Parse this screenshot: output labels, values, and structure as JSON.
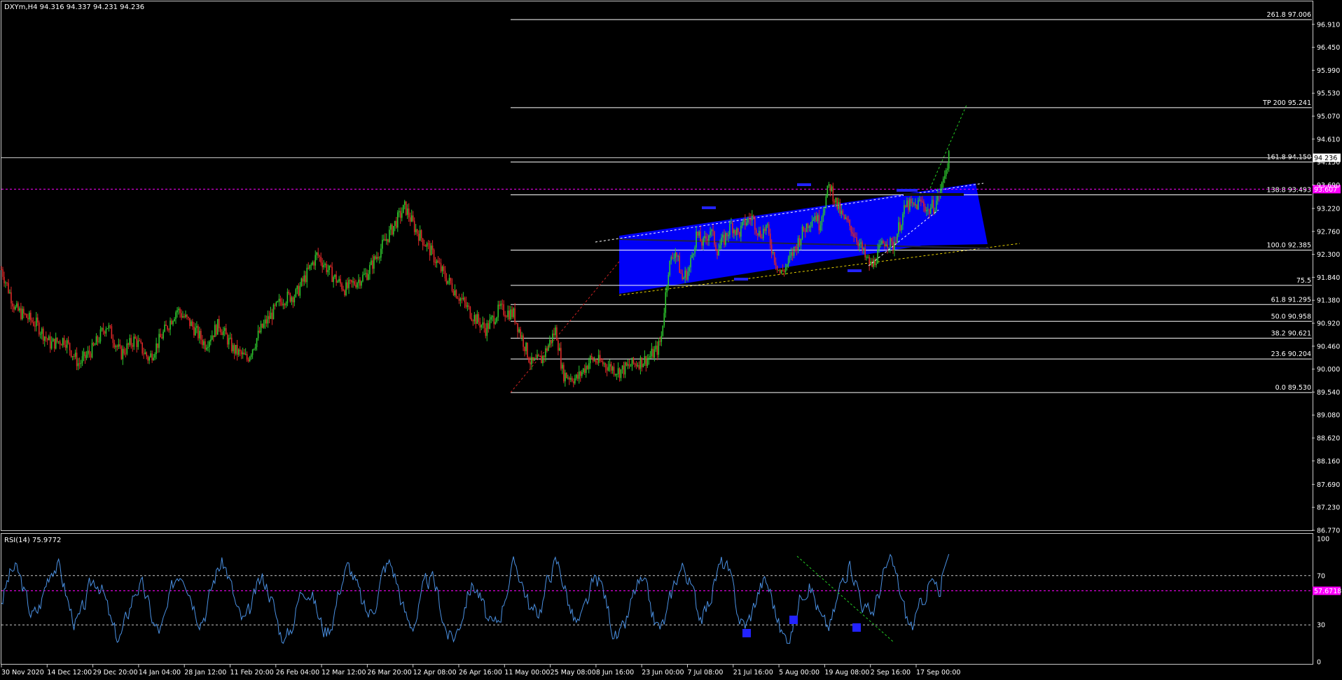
{
  "header": {
    "title": "DXYm,H4  94.316 94.337 94.231 94.236"
  },
  "rsi_panel": {
    "title": "RSI(14) 75.9772"
  },
  "colors": {
    "background": "#000000",
    "bull_candle": "#2ec82e",
    "bear_candle": "#dc2828",
    "channel_fill": "#0000ff",
    "fib_line": "#ffffff",
    "level_line": "#ff00ff",
    "rsi_line": "#4a90e2",
    "projection_line": "#22cc22"
  },
  "chart_data": [
    {
      "type": "candlestick",
      "symbol": "DXYm",
      "timeframe": "H4",
      "ohlc_last": {
        "open": 94.316,
        "high": 94.337,
        "low": 94.231,
        "close": 94.236
      },
      "current_price": "94.236",
      "ylim": [
        86.77,
        97.37
      ],
      "y_ticks": [
        "96.910",
        "96.450",
        "95.990",
        "95.530",
        "95.070",
        "94.610",
        "94.150",
        "93.690",
        "93.220",
        "92.760",
        "92.300",
        "91.840",
        "91.380",
        "90.920",
        "90.460",
        "90.000",
        "89.540",
        "89.080",
        "88.620",
        "88.160",
        "87.690",
        "87.230",
        "86.770"
      ],
      "x_ticks": [
        "30 Nov 2020",
        "14 Dec 12:00",
        "29 Dec 20:00",
        "14 Jan 04:00",
        "28 Jan 12:00",
        "11 Feb 20:00",
        "26 Feb 04:00",
        "12 Mar 12:00",
        "26 Mar 20:00",
        "12 Apr 08:00",
        "26 Apr 16:00",
        "11 May 00:00",
        "25 May 08:00",
        "8 Jun 16:00",
        "23 Jun 00:00",
        "7 Jul 08:00",
        "21 Jul 16:00",
        "5 Aug 00:00",
        "19 Aug 08:00",
        "2 Sep 16:00",
        "17 Sep 00:00"
      ],
      "price_path": [
        [
          0.0,
          92.0
        ],
        [
          0.02,
          91.2
        ],
        [
          0.05,
          90.9
        ],
        [
          0.07,
          90.5
        ],
        [
          0.09,
          90.6
        ],
        [
          0.11,
          90.1
        ],
        [
          0.13,
          90.4
        ],
        [
          0.15,
          90.9
        ],
        [
          0.17,
          90.3
        ],
        [
          0.19,
          90.6
        ],
        [
          0.21,
          90.2
        ],
        [
          0.23,
          90.7
        ],
        [
          0.25,
          91.2
        ],
        [
          0.27,
          90.9
        ],
        [
          0.29,
          90.5
        ],
        [
          0.31,
          90.9
        ],
        [
          0.33,
          90.4
        ],
        [
          0.35,
          90.2
        ],
        [
          0.37,
          90.8
        ],
        [
          0.4,
          91.4
        ],
        [
          0.42,
          91.5
        ],
        [
          0.45,
          92.3
        ],
        [
          0.47,
          91.9
        ],
        [
          0.49,
          91.6
        ],
        [
          0.52,
          91.9
        ],
        [
          0.54,
          92.4
        ],
        [
          0.56,
          92.9
        ],
        [
          0.575,
          93.25
        ],
        [
          0.59,
          92.8
        ],
        [
          0.61,
          92.4
        ],
        [
          0.63,
          91.9
        ],
        [
          0.65,
          91.5
        ],
        [
          0.67,
          91.1
        ],
        [
          0.69,
          90.8
        ],
        [
          0.71,
          91.2
        ],
        [
          0.73,
          91.1
        ],
        [
          0.745,
          90.5
        ],
        [
          0.755,
          90.1
        ],
        [
          0.77,
          90.2
        ],
        [
          0.79,
          90.8
        ],
        [
          0.8,
          89.9
        ],
        [
          0.82,
          89.8
        ],
        [
          0.84,
          90.2
        ],
        [
          0.86,
          90.1
        ],
        [
          0.88,
          89.95
        ],
        [
          0.9,
          90.1
        ],
        [
          0.92,
          90.2
        ],
        [
          0.935,
          90.4
        ],
        [
          0.94,
          90.6
        ],
        [
          0.95,
          92.0
        ],
        [
          0.96,
          92.4
        ],
        [
          0.97,
          91.8
        ],
        [
          0.98,
          92.0
        ],
        [
          0.99,
          92.7
        ],
        [
          1.0,
          92.5
        ],
        [
          1.01,
          92.8
        ],
        [
          1.02,
          92.4
        ],
        [
          1.03,
          92.6
        ],
        [
          1.04,
          92.9
        ],
        [
          1.05,
          92.7
        ],
        [
          1.06,
          92.95
        ],
        [
          1.07,
          93.05
        ],
        [
          1.08,
          92.7
        ],
        [
          1.09,
          92.85
        ],
        [
          1.1,
          92.3
        ],
        [
          1.11,
          91.9
        ],
        [
          1.12,
          92.1
        ],
        [
          1.13,
          92.4
        ],
        [
          1.14,
          92.7
        ],
        [
          1.15,
          92.95
        ],
        [
          1.16,
          93.1
        ],
        [
          1.165,
          92.9
        ],
        [
          1.18,
          93.7
        ],
        [
          1.19,
          93.3
        ],
        [
          1.2,
          93.0
        ],
        [
          1.21,
          92.85
        ],
        [
          1.22,
          92.6
        ],
        [
          1.23,
          92.25
        ],
        [
          1.24,
          92.05
        ],
        [
          1.25,
          92.35
        ],
        [
          1.26,
          92.6
        ],
        [
          1.27,
          92.45
        ],
        [
          1.28,
          92.9
        ],
        [
          1.29,
          93.3
        ],
        [
          1.3,
          93.25
        ],
        [
          1.31,
          93.35
        ],
        [
          1.315,
          93.3
        ],
        [
          1.32,
          93.15
        ],
        [
          1.325,
          93.25
        ],
        [
          1.33,
          93.3
        ],
        [
          1.34,
          93.65
        ],
        [
          1.345,
          94.0
        ],
        [
          1.35,
          94.236
        ]
      ]
    },
    {
      "type": "horizontal_levels",
      "fibonacci": [
        {
          "label": "261.8 97.006",
          "price": 97.006
        },
        {
          "label": "TP 200 95.241",
          "price": 95.241
        },
        {
          "label": "161.8 94.150",
          "price": 94.15
        },
        {
          "label": "138.8 93.493",
          "price": 93.493
        },
        {
          "label": "100.0 92.385",
          "price": 92.385
        },
        {
          "label": "75.5",
          "price": 91.68
        },
        {
          "label": "61.8 91.295",
          "price": 91.295
        },
        {
          "label": "50.0 90.958",
          "price": 90.958
        },
        {
          "label": "38.2 90.621",
          "price": 90.621
        },
        {
          "label": "23.6 90.204",
          "price": 90.204
        },
        {
          "label": "0.0 89.530",
          "price": 89.53
        }
      ],
      "magenta_level": {
        "label": "93.607",
        "price": 93.607
      },
      "current_price_label": "94.236"
    },
    {
      "type": "line",
      "indicator": "RSI(14)",
      "value": 75.9772,
      "ylim": [
        0,
        100
      ],
      "y_ticks": [
        "100",
        "70",
        "30",
        "0"
      ],
      "levels": [
        70,
        30
      ],
      "magenta_level": {
        "label": "57.6718",
        "value": 57.6718
      }
    }
  ]
}
